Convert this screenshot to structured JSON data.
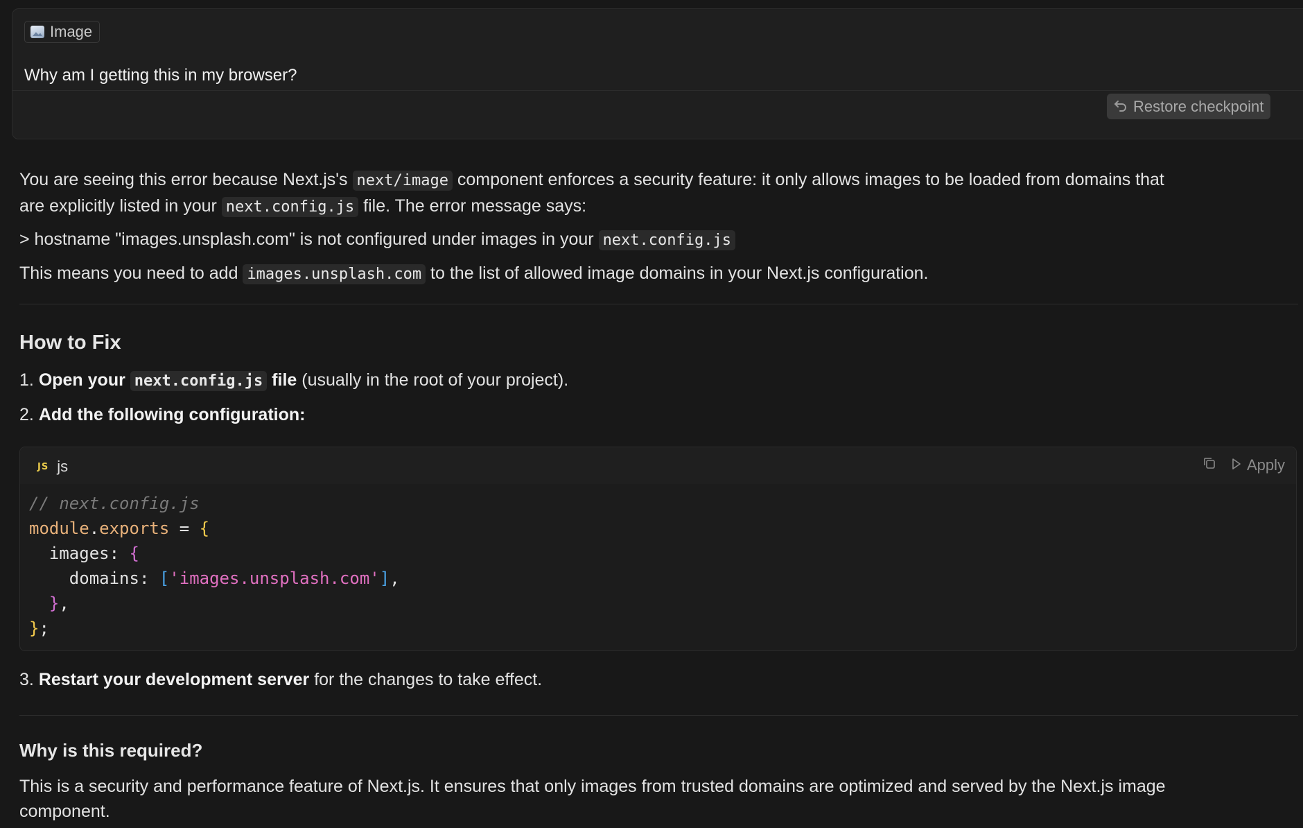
{
  "user_message": {
    "attachment_label": "Image",
    "text": "Why am I getting this in my browser?",
    "restore_label": "Restore checkpoint"
  },
  "response": {
    "p1_a": "You are seeing this error because Next.js's ",
    "p1_code1": "next/image",
    "p1_b": " component enforces a security feature: it only allows images to be loaded from domains that",
    "p1_c": "are explicitly listed in your ",
    "p1_code2": "next.config.js",
    "p1_d": " file. The error message says:",
    "p2_a": "> hostname \"images.unsplash.com\" is not configured under images in your ",
    "p2_code": "next.config.js",
    "p3_a": "This means you need to add ",
    "p3_code": "images.unsplash.com",
    "p3_b": " to the list of allowed image domains in your Next.js configuration.",
    "heading_fix": "How to Fix",
    "step1_num": "1.",
    "step1_bold_a": "Open your",
    "step1_code": "next.config.js",
    "step1_bold_b": "file",
    "step1_rest": " (usually in the root of your project).",
    "step2_num": "2.",
    "step2_bold": "Add the following configuration:",
    "step3_num": "3.",
    "step3_bold": "Restart your development server",
    "step3_rest": " for the changes to take effect.",
    "heading_why": "Why is this required?",
    "why_line1": "This is a security and performance feature of Next.js. It ensures that only images from trusted domains are optimized and served by the Next.js image",
    "why_line2": "component."
  },
  "code_block": {
    "lang_badge": "JS",
    "lang": "js",
    "apply_label": "Apply",
    "lines": {
      "l1": "// next.config.js",
      "l2_a": "module",
      "l2_b": ".",
      "l2_c": "exports",
      "l2_d": " = ",
      "l2_e": "{",
      "l3_a": "  images: ",
      "l3_b": "{",
      "l4_a": "    domains: ",
      "l4_b": "[",
      "l4_c": "'images.unsplash.com'",
      "l4_d": "]",
      "l4_e": ",",
      "l5_a": "  ",
      "l5_b": "}",
      "l5_c": ",",
      "l6_a": "}",
      "l6_b": ";"
    }
  },
  "icons": {
    "attachment": "image-icon",
    "restore": "undo-arrow-icon",
    "copy": "copy-icon",
    "apply": "play-icon"
  }
}
